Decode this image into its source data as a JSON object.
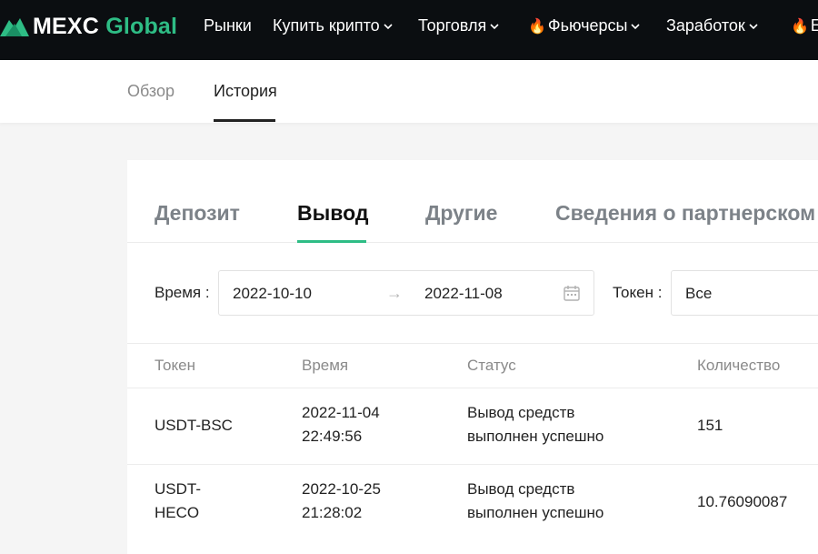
{
  "topnav": {
    "logo": {
      "brand": "MEXC",
      "suffix": "Global"
    },
    "items": [
      {
        "label": "Рынки",
        "fire": false,
        "dropdown": false
      },
      {
        "label": "Купить крипто",
        "fire": false,
        "dropdown": true
      },
      {
        "label": "Торговля",
        "fire": false,
        "dropdown": true
      },
      {
        "label": "Фьючерсы",
        "fire": true,
        "dropdown": true
      },
      {
        "label": "Заработок",
        "fire": false,
        "dropdown": true
      },
      {
        "label": "E",
        "fire": true,
        "dropdown": false
      }
    ]
  },
  "subnav": {
    "tabs": [
      {
        "label": "Обзор",
        "active": false
      },
      {
        "label": "История",
        "active": true
      }
    ]
  },
  "type_tabs": [
    {
      "label": "Депозит",
      "active": false
    },
    {
      "label": "Вывод",
      "active": true
    },
    {
      "label": "Другие",
      "active": false
    },
    {
      "label": "Сведения о партнерском п",
      "active": false
    }
  ],
  "filters": {
    "time_label": "Время :",
    "date_from": "2022-10-10",
    "date_to": "2022-11-08",
    "token_label": "Токен :",
    "token_value": "Все"
  },
  "table": {
    "headers": [
      "Токен",
      "Время",
      "Статус",
      "Количество"
    ],
    "rows": [
      {
        "token": [
          "USDT-BSC"
        ],
        "time": [
          "2022-11-04",
          "22:49:56"
        ],
        "status": [
          "Вывод средств",
          "выполнен успешно"
        ],
        "amount": "151"
      },
      {
        "token": [
          "USDT-",
          "HECO"
        ],
        "time": [
          "2022-10-25",
          "21:28:02"
        ],
        "status": [
          "Вывод средств",
          "выполнен успешно"
        ],
        "amount": "10.76090087"
      }
    ]
  },
  "colors": {
    "accent": "#2ebd85",
    "nav_bg": "#0b0e11"
  }
}
